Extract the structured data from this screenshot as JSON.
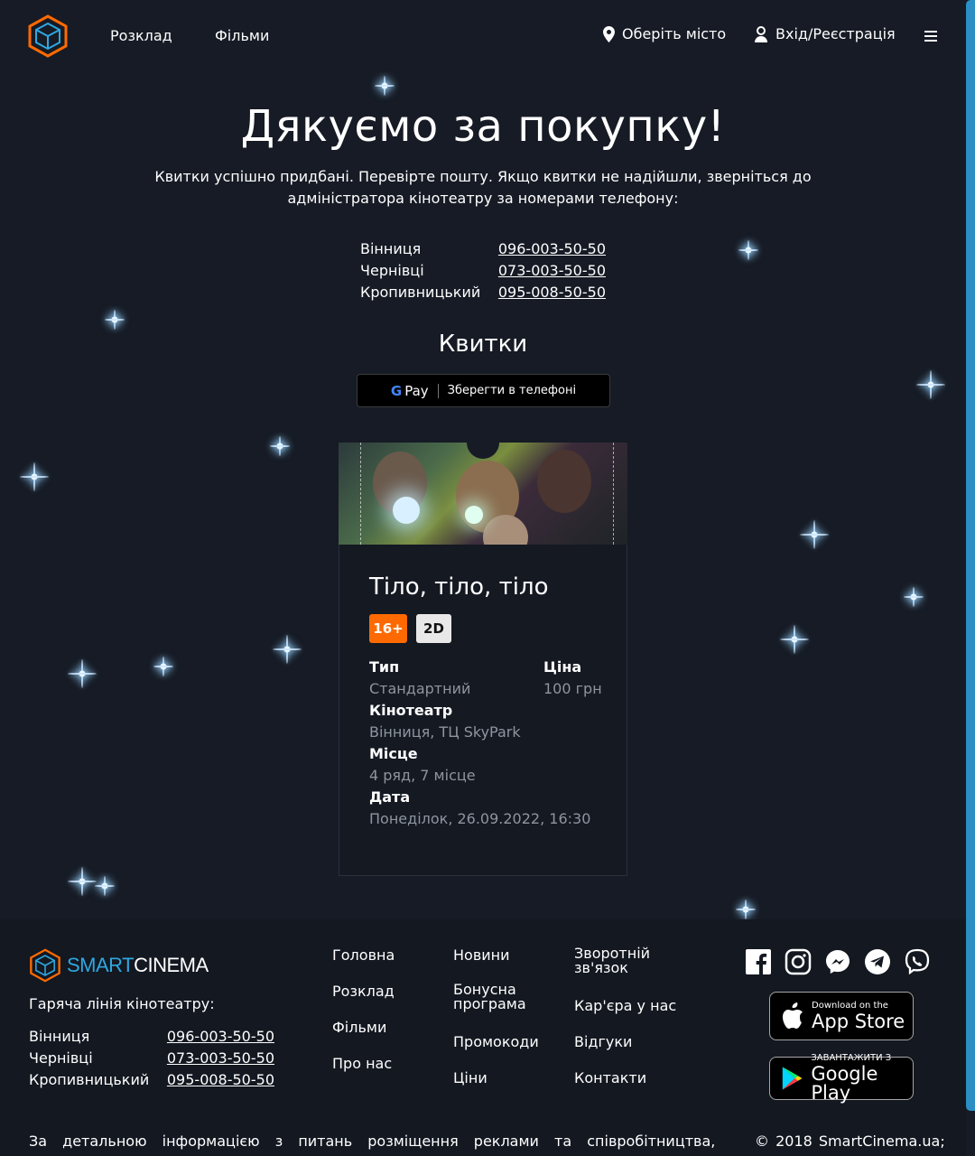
{
  "header": {
    "nav": {
      "schedule": "Розклад",
      "films": "Фільми"
    },
    "city_label": "Оберіть місто",
    "login_label": "Вхід/Реєстрація",
    "icons": {
      "logo": "cube-logo-icon",
      "location": "map-pin-icon",
      "user": "user-icon",
      "menu": "hamburger-menu-icon"
    }
  },
  "thanks": {
    "title": "Дякуємо за покупку!",
    "subtitle": "Квитки успішно придбані. Перевірте пошту. Якщо квитки не надійшли, зверніться до адміністратора кінотеатру за номерами телефону:",
    "phones": [
      {
        "city": "Вінниця",
        "phone": "096-003-50-50"
      },
      {
        "city": "Чернівці",
        "phone": "073-003-50-50"
      },
      {
        "city": "Кропивницький",
        "phone": "095-008-50-50"
      }
    ]
  },
  "tickets": {
    "heading": "Квитки",
    "gpay": {
      "g": "G",
      "pay": "Pay",
      "label": "Зберегти в телефоні"
    }
  },
  "ticket": {
    "movie_title": "Тіло, тіло, тіло",
    "age_rating": "16+",
    "format": "2D",
    "type_label": "Тип",
    "type_value": "Стандартний",
    "price_label": "Ціна",
    "price_value": "100 грн",
    "cinema_label": "Кінотеатр",
    "cinema_value": "Вінниця, ТЦ SkyPark",
    "seat_label": "Місце",
    "seat_value": "4 ряд, 7 місце",
    "date_label": "Дата",
    "date_value": "Понеділок, 26.09.2022, 16:30"
  },
  "footer": {
    "brand_smart": "SMART",
    "brand_cinema": "CINEMA",
    "hotline": "Гаряча лінія кінотеатру:",
    "phones": [
      {
        "city": "Вінниця",
        "phone": "096-003-50-50"
      },
      {
        "city": "Чернівці",
        "phone": "073-003-50-50"
      },
      {
        "city": "Кропивницький",
        "phone": "095-008-50-50"
      }
    ],
    "col1": [
      "Головна",
      "Розклад",
      "Фільми",
      "Про нас"
    ],
    "col2": [
      "Новини",
      "Бонусна програма",
      "Промокоди",
      "Ціни"
    ],
    "col3": [
      "Зворотній зв'язок",
      "Кар'єра у нас",
      "Відгуки",
      "Контакти"
    ],
    "social_icons": [
      "facebook-icon",
      "instagram-icon",
      "messenger-icon",
      "telegram-icon",
      "viber-icon"
    ],
    "appstore": {
      "small": "Download on the",
      "large": "App Store"
    },
    "playstore": {
      "small": "ЗАВАНТАЖИТИ З",
      "large": "Google Play"
    },
    "note": "За детальною інформацією з питань розміщення реклами та співробітництва,",
    "copyright": "© 2018 SmartCinema.ua;"
  },
  "colors": {
    "background": "#161b25",
    "accent_orange": "#ff6a00",
    "accent_blue": "#2fa7e0"
  }
}
